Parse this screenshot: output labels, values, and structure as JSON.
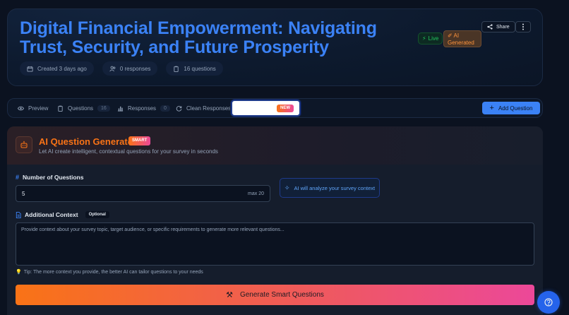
{
  "header": {
    "title": "Digital Financial Empowerment: Navigating Trust, Security, and Future Prosperity",
    "meta": {
      "created": "Created 3 days ago",
      "responses": "0 responses",
      "questions": "16 questions"
    },
    "status_badge": "Live",
    "ai_badge": "AI Generated",
    "share_label": "Share"
  },
  "tabs": {
    "preview": "Preview",
    "questions": "Questions",
    "questions_count": "16",
    "responses": "Responses",
    "responses_count": "0",
    "clean": "Clean Responses",
    "new_badge": "NEW",
    "add_question": "Add Question"
  },
  "generator": {
    "title": "AI Question Generator",
    "smart_badge": "SMART",
    "subtitle": "Let AI create intelligent, contextual questions for your survey in seconds",
    "num_label": "Number of Questions",
    "num_value": "5",
    "num_max": "max 20",
    "analyze_note": "AI will analyze your survey context",
    "context_label": "Additional Context",
    "optional_badge": "Optional",
    "context_placeholder": "Provide context about your survey topic, target audience, or specific requirements to generate more relevant questions...",
    "tip": "Tip: The more context you provide, the better AI can tailor questions to your needs",
    "generate_button": "Generate Smart Questions"
  },
  "colors": {
    "accent_blue": "#3b82f6",
    "accent_orange": "#f97316",
    "accent_pink": "#ec4899",
    "live_green": "#22c55e"
  }
}
